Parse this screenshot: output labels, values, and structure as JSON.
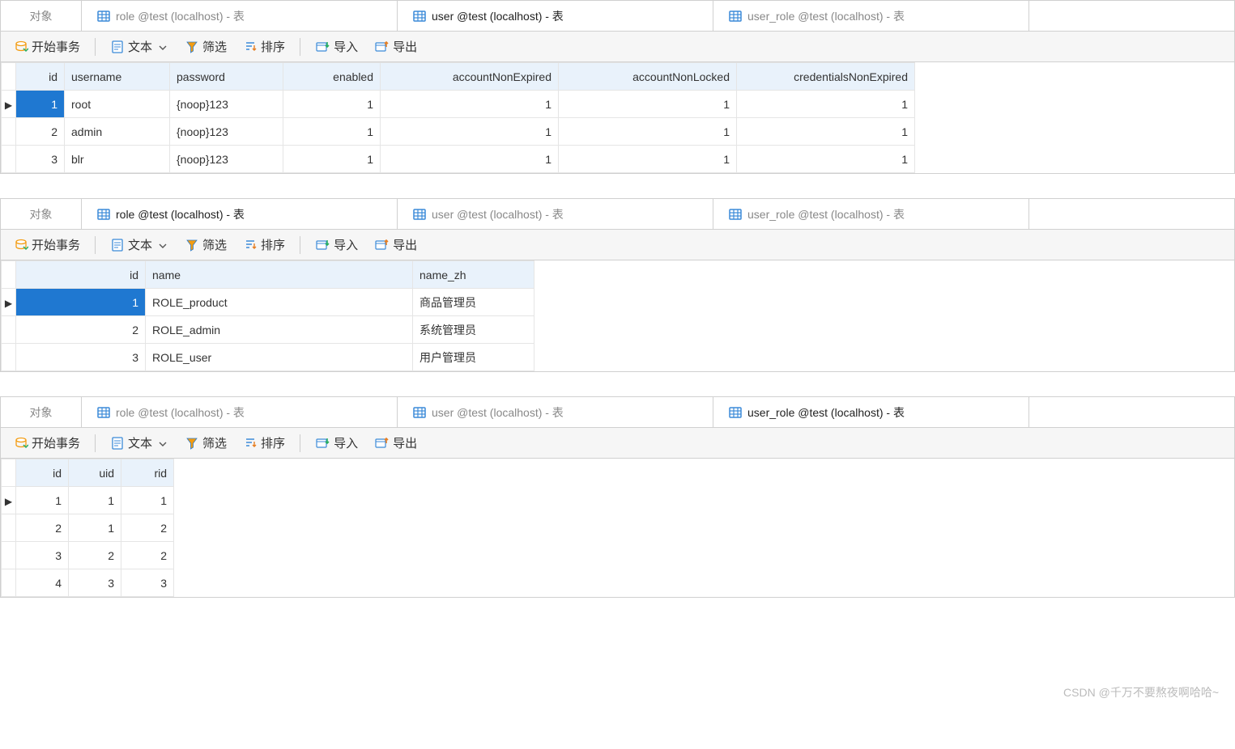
{
  "watermark": "CSDN @千万不要熬夜啊哈哈~",
  "tabs": {
    "objects": "对象",
    "role": "role @test (localhost) - 表",
    "user": "user @test (localhost) - 表",
    "user_role": "user_role @test (localhost) - 表"
  },
  "toolbar": {
    "begin_transaction": "开始事务",
    "text": "文本",
    "filter": "筛选",
    "sort": "排序",
    "import": "导入",
    "export": "导出"
  },
  "panel1": {
    "columns": [
      "id",
      "username",
      "password",
      "enabled",
      "accountNonExpired",
      "accountNonLocked",
      "credentialsNonExpired"
    ],
    "rows": [
      {
        "id": 1,
        "username": "root",
        "password": "{noop}123",
        "enabled": 1,
        "accountNonExpired": 1,
        "accountNonLocked": 1,
        "credentialsNonExpired": 1
      },
      {
        "id": 2,
        "username": "admin",
        "password": "{noop}123",
        "enabled": 1,
        "accountNonExpired": 1,
        "accountNonLocked": 1,
        "credentialsNonExpired": 1
      },
      {
        "id": 3,
        "username": "blr",
        "password": "{noop}123",
        "enabled": 1,
        "accountNonExpired": 1,
        "accountNonLocked": 1,
        "credentialsNonExpired": 1
      }
    ]
  },
  "panel2": {
    "columns": [
      "id",
      "name",
      "name_zh"
    ],
    "rows": [
      {
        "id": 1,
        "name": "ROLE_product",
        "name_zh": "商品管理员"
      },
      {
        "id": 2,
        "name": "ROLE_admin",
        "name_zh": "系统管理员"
      },
      {
        "id": 3,
        "name": "ROLE_user",
        "name_zh": "用户管理员"
      }
    ]
  },
  "panel3": {
    "columns": [
      "id",
      "uid",
      "rid"
    ],
    "rows": [
      {
        "id": 1,
        "uid": 1,
        "rid": 1
      },
      {
        "id": 2,
        "uid": 1,
        "rid": 2
      },
      {
        "id": 3,
        "uid": 2,
        "rid": 2
      },
      {
        "id": 4,
        "uid": 3,
        "rid": 3
      }
    ]
  }
}
